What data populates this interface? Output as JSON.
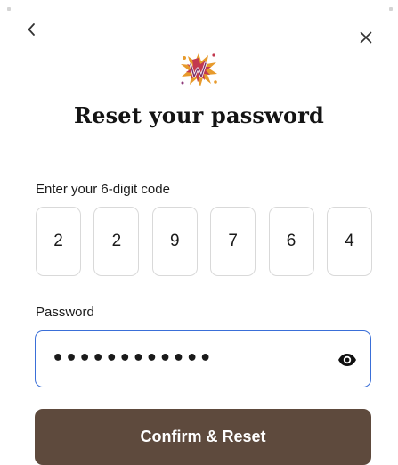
{
  "header": {
    "back_icon": "chevron-left-icon",
    "close_icon": "close-icon",
    "logo_icon": "splash-w-logo"
  },
  "title": "Reset your password",
  "code": {
    "label": "Enter your 6-digit code",
    "digits": [
      "2",
      "2",
      "9",
      "7",
      "6",
      "4"
    ]
  },
  "password": {
    "label": "Password",
    "value": "••••••••••••",
    "toggle_icon": "eye-icon"
  },
  "confirm_button": {
    "label": "Confirm & Reset"
  },
  "colors": {
    "primary_button": "#5e4a3d",
    "focus_border": "#3a6fd8",
    "input_border": "#d9d9d9"
  }
}
